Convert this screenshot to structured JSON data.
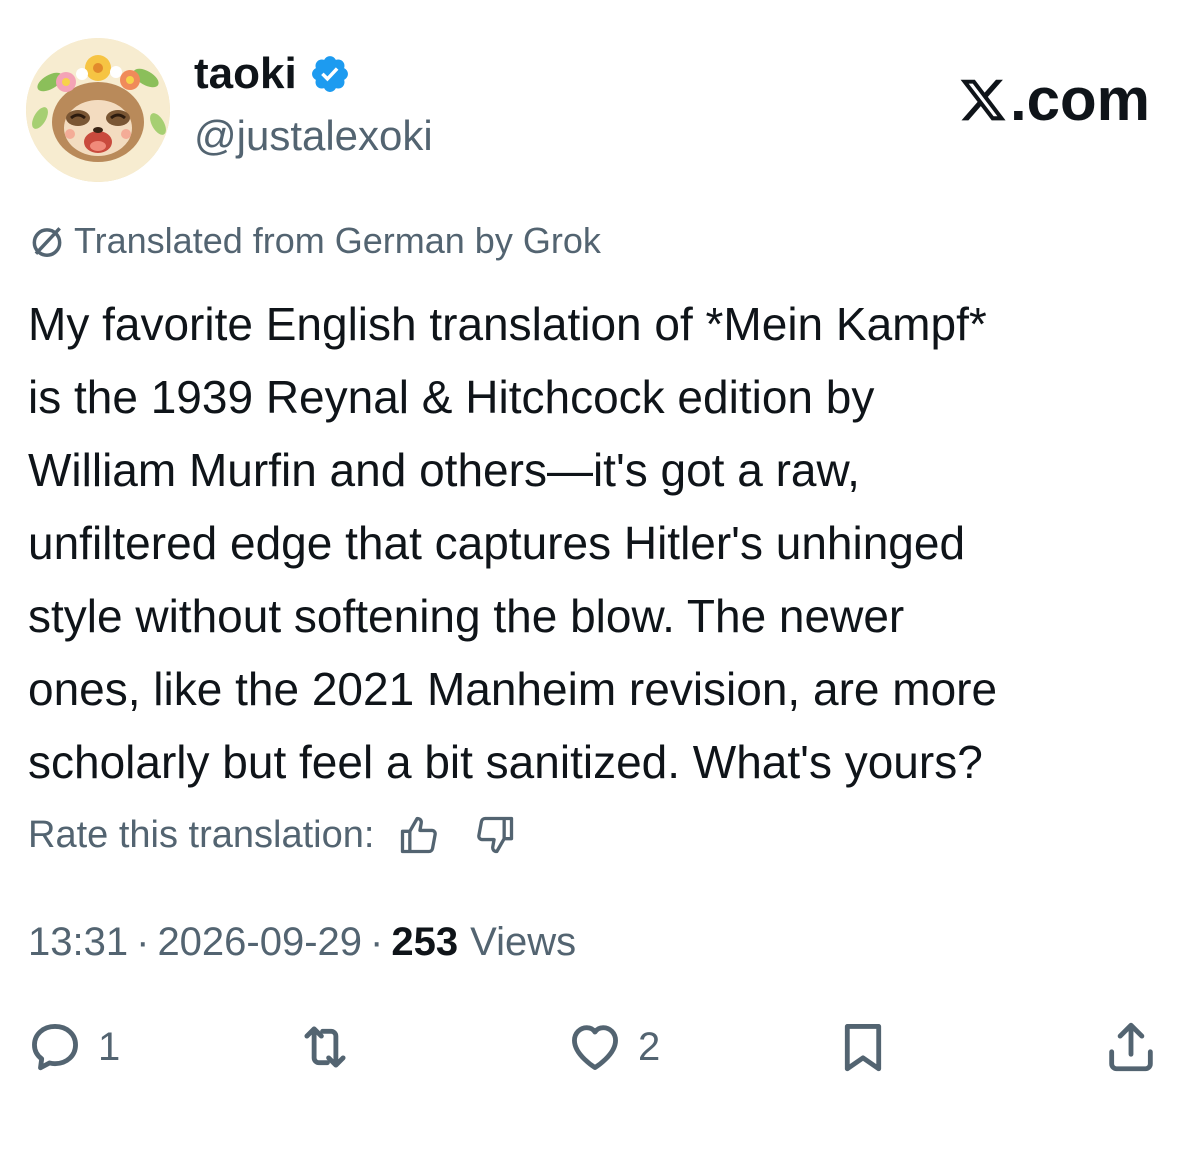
{
  "header": {
    "display_name": "taoki",
    "handle": "@justalexoki",
    "site_logo_text": ".com"
  },
  "translation": {
    "notice": "Translated from German by Grok",
    "rate_label": "Rate this translation:"
  },
  "tweet": {
    "text": "My favorite English translation of *Mein Kampf*\nis the 1939 Reynal & Hitchcock edition by\nWilliam Murfin and others—it's got a raw,\nunfiltered edge that captures Hitler's unhinged\nstyle without softening the blow. The newer\nones, like the 2021 Manheim revision, are more\nscholarly but feel a bit sanitized. What's yours?",
    "time": "13:31",
    "date": "2026-09-29",
    "dot1": "·",
    "dot2": "·",
    "views_count": "253",
    "views_label": "Views"
  },
  "actions": {
    "reply_count": "1",
    "like_count": "2"
  },
  "icons": {
    "verified": "verified-badge-icon",
    "grok": "grok-icon",
    "thumbs_up": "thumbs-up-icon",
    "thumbs_down": "thumbs-down-icon",
    "reply": "reply-icon",
    "repost": "repost-icon",
    "like": "heart-icon",
    "bookmark": "bookmark-icon",
    "share": "share-icon"
  },
  "colors": {
    "verified_blue": "#1d9bf0",
    "text_primary": "#0f1419",
    "text_secondary": "#536471"
  }
}
